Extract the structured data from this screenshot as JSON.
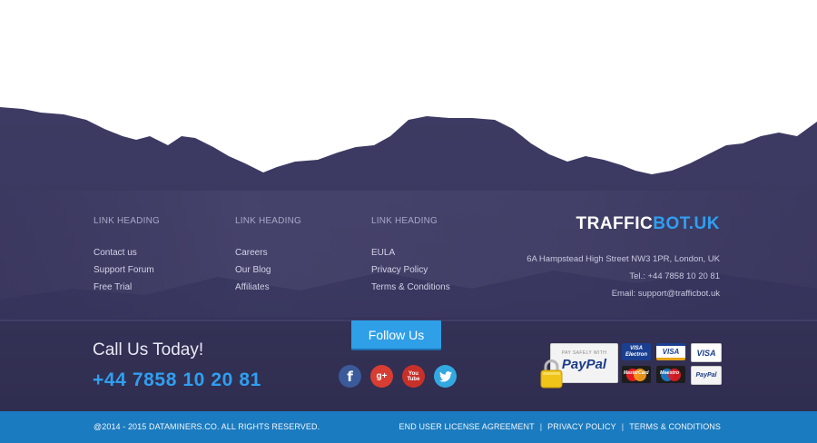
{
  "columns": [
    {
      "heading": "LINK HEADING",
      "links": [
        "Contact us",
        "Support Forum",
        "Free Trial"
      ]
    },
    {
      "heading": "LINK HEADING",
      "links": [
        "Careers",
        "Our Blog",
        "Affiliates"
      ]
    },
    {
      "heading": "LINK HEADING",
      "links": [
        "EULA",
        "Privacy Policy",
        "Terms & Conditions"
      ]
    }
  ],
  "brand": {
    "part1": "TRAFFIC",
    "part2": "BOT.UK"
  },
  "contact": {
    "address": "6A Hampstead High Street NW3 1PR, London, UK",
    "tel": "Tel.: +44 7858 10 20 81",
    "email": "Email: support@trafficbot.uk"
  },
  "call": {
    "title": "Call Us Today!",
    "number": "+44 7858 10 20 81"
  },
  "follow": {
    "label": "Follow Us"
  },
  "social": [
    {
      "name": "facebook",
      "glyph": "f",
      "color": "#3b5a9a"
    },
    {
      "name": "google-plus",
      "glyph": "g+",
      "color": "#d73d32"
    },
    {
      "name": "youtube",
      "glyph": "You Tube",
      "color": "#c8302a"
    },
    {
      "name": "twitter",
      "glyph": "t",
      "color": "#33a8e0"
    }
  ],
  "payments": {
    "paypal_caption": "PAY SAFELY WITH",
    "paypal_word": "PayPal",
    "cards_row1": [
      "VISA Electron",
      "VISA",
      "VISA"
    ],
    "cards_row2": [
      "MasterCard",
      "Maestro",
      "PayPal"
    ]
  },
  "bottom": {
    "copyright": "@2014 - 2015 DATAMINERS.CO. ALL RIGHTS RESERVED.",
    "links": [
      "END USER LICENSE AGREEMENT",
      "PRIVACY POLICY",
      "TERMS & CONDITIONS"
    ]
  },
  "colors": {
    "accent": "#2f9ff0",
    "footer_bg": "#3a375f",
    "bar": "#1b7bc0"
  }
}
